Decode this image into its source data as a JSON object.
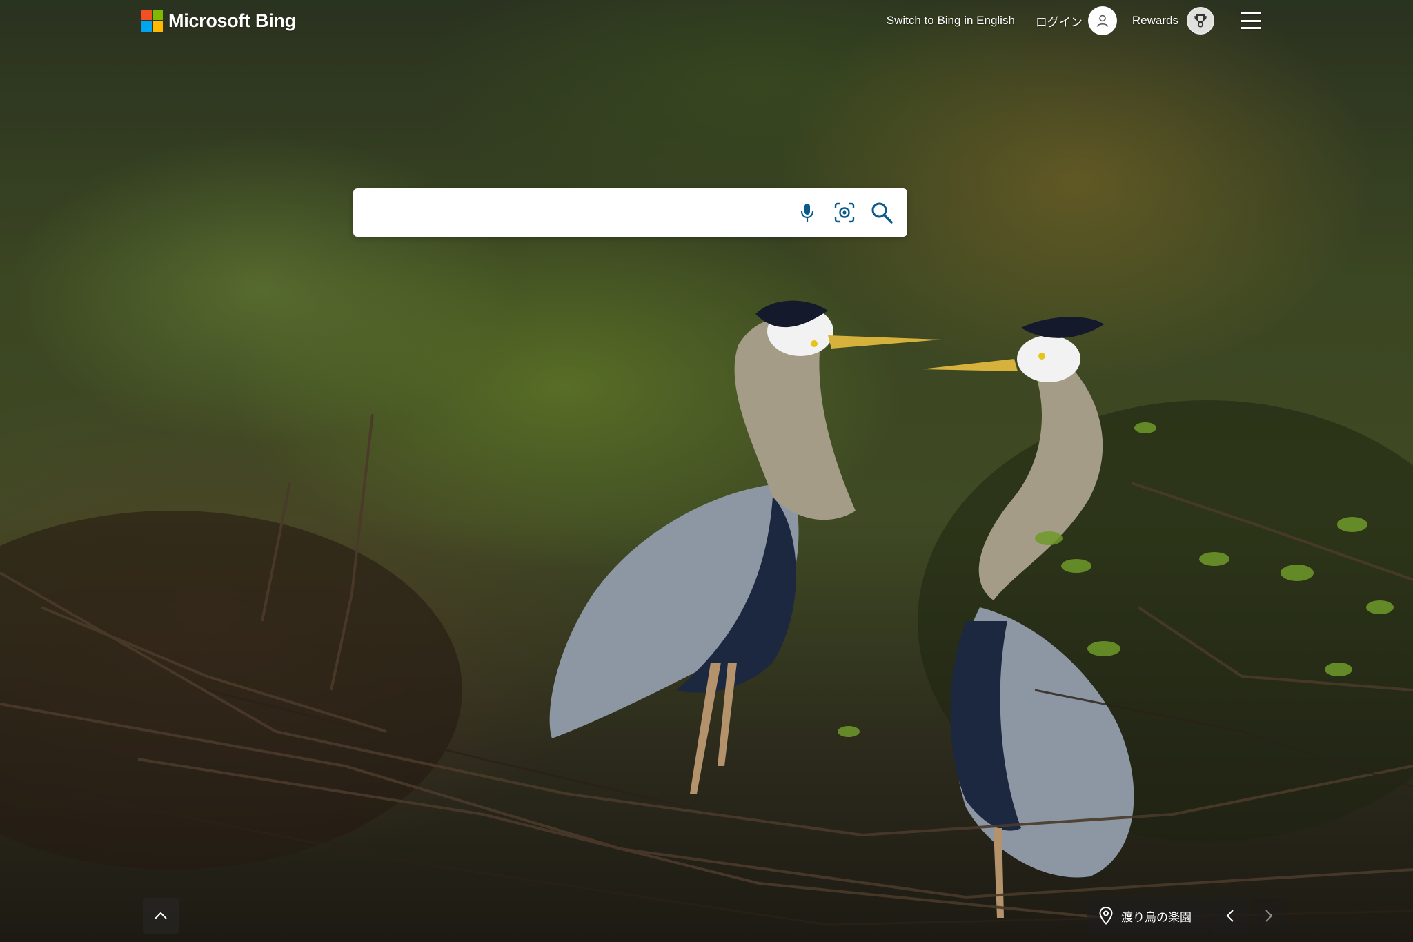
{
  "brand": {
    "name": "Microsoft Bing",
    "colors": {
      "red": "#f25022",
      "green": "#7fba00",
      "blue": "#00a4ef",
      "yellow": "#ffb900"
    }
  },
  "header": {
    "switch_language_label": "Switch to Bing in English",
    "login_label": "ログイン",
    "rewards_label": "Rewards",
    "menu_icon": "hamburger-menu-icon"
  },
  "search": {
    "value": "",
    "placeholder": "",
    "icons": [
      "microphone-icon",
      "visual-search-icon",
      "search-icon"
    ],
    "accent": "#0a5b8c"
  },
  "image_of_day": {
    "title": "渡り鳥の楽園",
    "icon": "location-pin-icon"
  },
  "controls": {
    "scroll_up_icon": "chevron-up-icon",
    "prev_icon": "chevron-left-icon",
    "next_icon": "chevron-right-icon"
  }
}
